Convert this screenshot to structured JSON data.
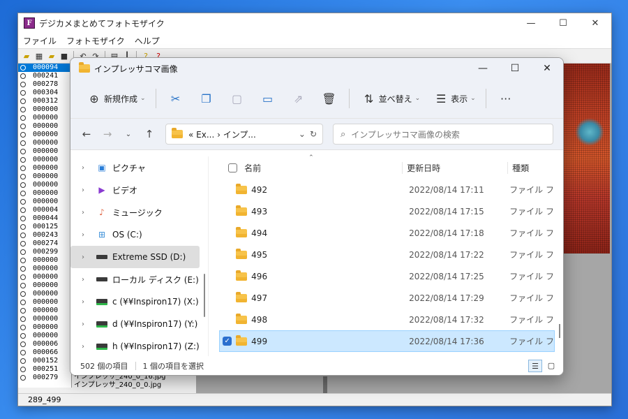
{
  "app": {
    "title": "デジカメまとめてフォトモザイク",
    "icon_letter": "F",
    "minimize": "—",
    "maximize": "☐",
    "close": "✕",
    "menu": [
      "ファイル",
      "フォトモザイク",
      "ヘルプ"
    ],
    "numbers": [
      "000094",
      "000241",
      "000278",
      "000304",
      "000312",
      "000000",
      "000000",
      "000000",
      "000000",
      "000000",
      "000000",
      "000000",
      "000000",
      "000000",
      "000000",
      "000000",
      "000000",
      "000004",
      "000044",
      "000125",
      "000243",
      "000274",
      "000299",
      "000000",
      "000000",
      "000000",
      "000000",
      "000000",
      "000000",
      "000000",
      "000000",
      "000000",
      "000000",
      "000006",
      "000066",
      "000152",
      "000251",
      "000279"
    ],
    "file_lines": [
      "インプレッサ_240_0_16.jpg",
      "インプレッサ_240_0_0.jpg"
    ],
    "status": "289_499"
  },
  "explorer": {
    "title": "インプレッサコマ画像",
    "minimize": "—",
    "maximize": "☐",
    "close": "✕",
    "new_label": "新規作成",
    "sort_label": "並べ替え",
    "view_label": "表示",
    "more": "···",
    "address": "« Ex... › インプ...",
    "search_placeholder": "インプレッサコマ画像の検索",
    "nav_items": [
      {
        "label": "ピクチャ",
        "icon": "pictures-icon"
      },
      {
        "label": "ビデオ",
        "icon": "videos-icon"
      },
      {
        "label": "ミュージック",
        "icon": "music-icon"
      },
      {
        "label": "OS (C:)",
        "icon": "os-drive-icon"
      },
      {
        "label": "Extreme SSD (D:)",
        "icon": "drive-icon"
      },
      {
        "label": "ローカル ディスク (E:)",
        "icon": "drive-icon"
      },
      {
        "label": "c (¥¥Inspiron17) (X:)",
        "icon": "network-drive-icon"
      },
      {
        "label": "d (¥¥Inspiron17) (Y:)",
        "icon": "network-drive-icon"
      },
      {
        "label": "h (¥¥Inspiron17) (Z:)",
        "icon": "network-drive-icon"
      }
    ],
    "columns": {
      "name": "名前",
      "date": "更新日時",
      "type": "種類"
    },
    "files": [
      {
        "name": "492",
        "date": "2022/08/14 17:11",
        "type": "ファイル フ"
      },
      {
        "name": "493",
        "date": "2022/08/14 17:15",
        "type": "ファイル フ"
      },
      {
        "name": "494",
        "date": "2022/08/14 17:18",
        "type": "ファイル フ"
      },
      {
        "name": "495",
        "date": "2022/08/14 17:22",
        "type": "ファイル フ"
      },
      {
        "name": "496",
        "date": "2022/08/14 17:25",
        "type": "ファイル フ"
      },
      {
        "name": "497",
        "date": "2022/08/14 17:29",
        "type": "ファイル フ"
      },
      {
        "name": "498",
        "date": "2022/08/14 17:32",
        "type": "ファイル フ"
      },
      {
        "name": "499",
        "date": "2022/08/14 17:36",
        "type": "ファイル フ"
      }
    ],
    "status_count": "502 個の項目",
    "status_selected": "1 個の項目を選択"
  }
}
